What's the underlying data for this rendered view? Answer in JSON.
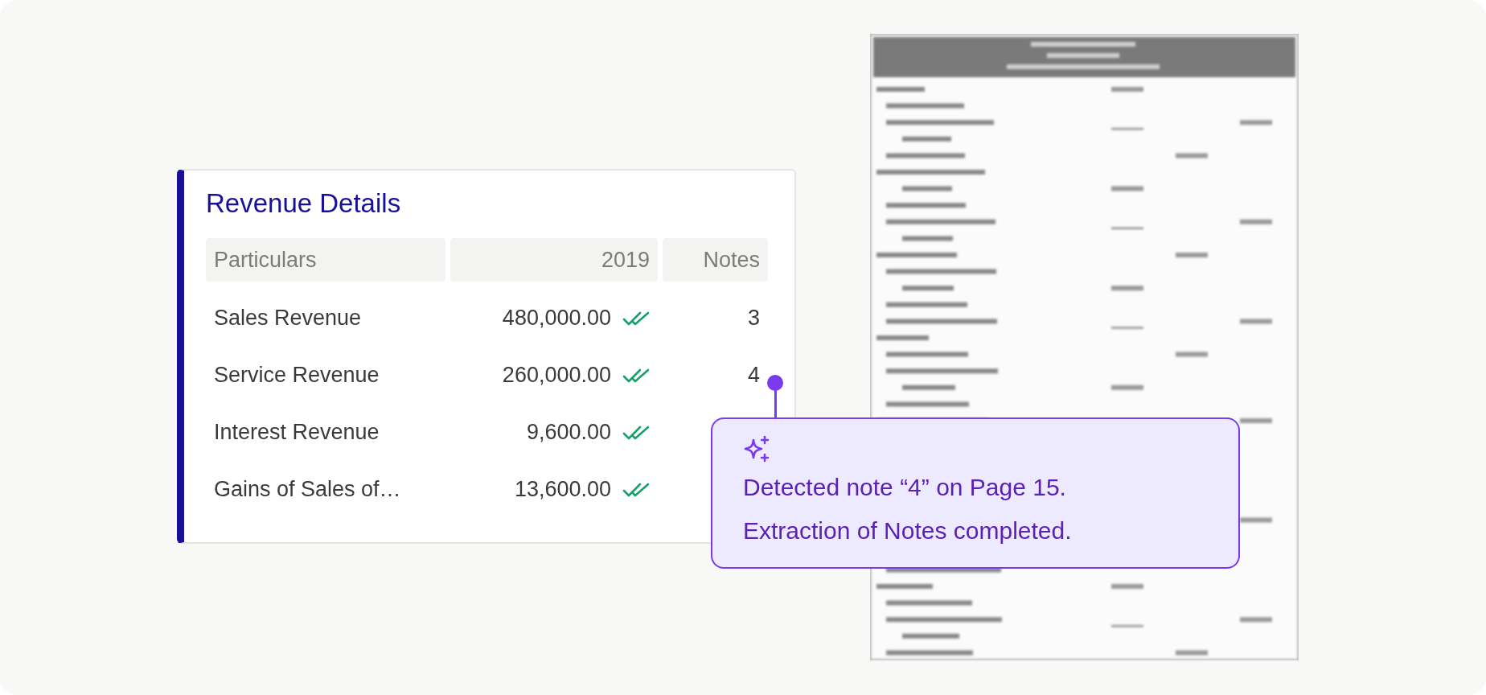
{
  "card": {
    "title": "Revenue Details",
    "columns": [
      "Particulars",
      "2019",
      "Notes"
    ],
    "rows": [
      {
        "particular": "Sales Revenue",
        "amount": "480,000.00",
        "verified": true,
        "note": "3"
      },
      {
        "particular": "Service Revenue",
        "amount": "260,000.00",
        "verified": true,
        "note": "4"
      },
      {
        "particular": "Interest Revenue",
        "amount": "9,600.00",
        "verified": true
      },
      {
        "particular": "Gains of Sales of…",
        "amount": "13,600.00",
        "verified": true
      }
    ]
  },
  "tooltip": {
    "lines": [
      "Detected note “4” on Page 15.",
      "Extraction of Notes completed."
    ]
  }
}
